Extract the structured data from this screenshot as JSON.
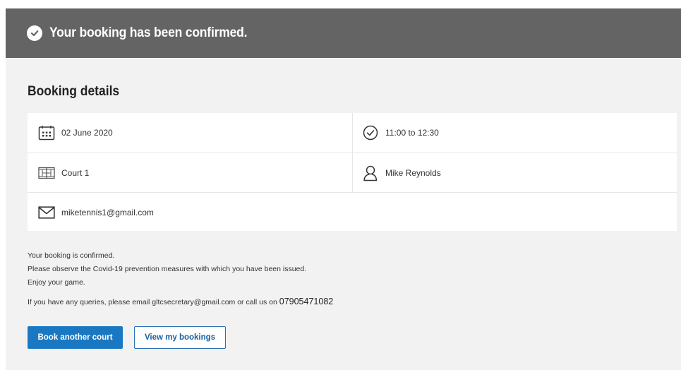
{
  "banner": {
    "icon": "check-circle-icon",
    "title": "Your booking has been confirmed."
  },
  "section": {
    "title": "Booking details"
  },
  "details": {
    "date": {
      "icon": "calendar-icon",
      "value": "02 June 2020"
    },
    "time": {
      "icon": "clock-icon",
      "value": "11:00 to 12:30"
    },
    "court": {
      "icon": "court-icon",
      "value": "Court 1"
    },
    "player": {
      "icon": "user-icon",
      "value": "Mike Reynolds"
    },
    "email": {
      "icon": "envelope-icon",
      "value": "miketennis1@gmail.com"
    }
  },
  "notes": {
    "line1": "Your booking is confirmed.",
    "line2": "Please observe the Covid-19 prevention measures with which you have been issued.",
    "line3": "Enjoy your game.",
    "query_prefix": "If you have any queries, please email gltcsecretary@gmail.com or call us on ",
    "phone": "07905471082"
  },
  "actions": {
    "book_another": "Book another court",
    "view_bookings": "View my bookings"
  },
  "colors": {
    "banner_bg": "#646464",
    "primary": "#1a78c2",
    "page_bg": "#f2f2f2"
  }
}
